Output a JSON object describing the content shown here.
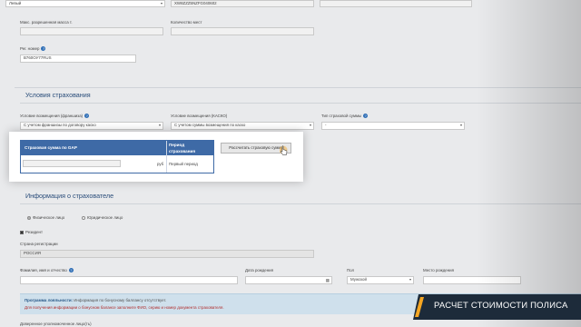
{
  "top_fields": {
    "left_select": "Левый",
    "vin": "XW8ZZZ5NZFG040602",
    "max_mass_label": "Макс. разрешенная масса т.",
    "seats_label": "Количество мест",
    "reg_number_label": "Рег. номер",
    "reg_number_value": "В760ОУ77RUS",
    "help": "?"
  },
  "insurance": {
    "title": "Условия страхования",
    "franchise_label": "Условие возмещения (франшиза)",
    "franchise_value": "С учетом франшизы по договору каско",
    "kasko_label": "Условие возмещения (КАСКО)",
    "kasko_value": "С учетом суммы возмещения по каско",
    "sum_type_label": "Тип страховой суммы",
    "sum_type_value": "-",
    "help": "?"
  },
  "gap_table": {
    "col1": "Страховая сумма по GAP",
    "col2_line1": "Период",
    "col2_line2": "страхования",
    "currency": "руб",
    "period": "Первый период",
    "calc_button": "Рассчитать страховую сумму"
  },
  "insurer": {
    "title": "Информация о страхователе",
    "radio_person": "Физическое лицо",
    "radio_legal": "Юридическое лицо",
    "resident": "Резидент",
    "country_label": "Страна регистрации",
    "country_value": "РОССИЯ",
    "fio_label": "Фамилия, имя и отчество",
    "birthdate_label": "Дата рождения",
    "gender_label": "Пол",
    "gender_value": "Мужской",
    "birthplace_label": "Место рождения",
    "help": "?"
  },
  "loyalty": {
    "line1_bold": "Программа лояльности:",
    "line1_rest": "Информация по бонусному баллансу отсутствует.",
    "line2": "Для получения информации о бонусном балансе заполните ФИО, серию и номер документа страхователя."
  },
  "bottom_cut": "Доверенное уполномоченное лицо(ть)",
  "banner": {
    "text": "РАСЧЕТ СТОИМОСТИ ПОЛИСА",
    "accent": "#f5a623",
    "background": "#1d2b3a"
  }
}
